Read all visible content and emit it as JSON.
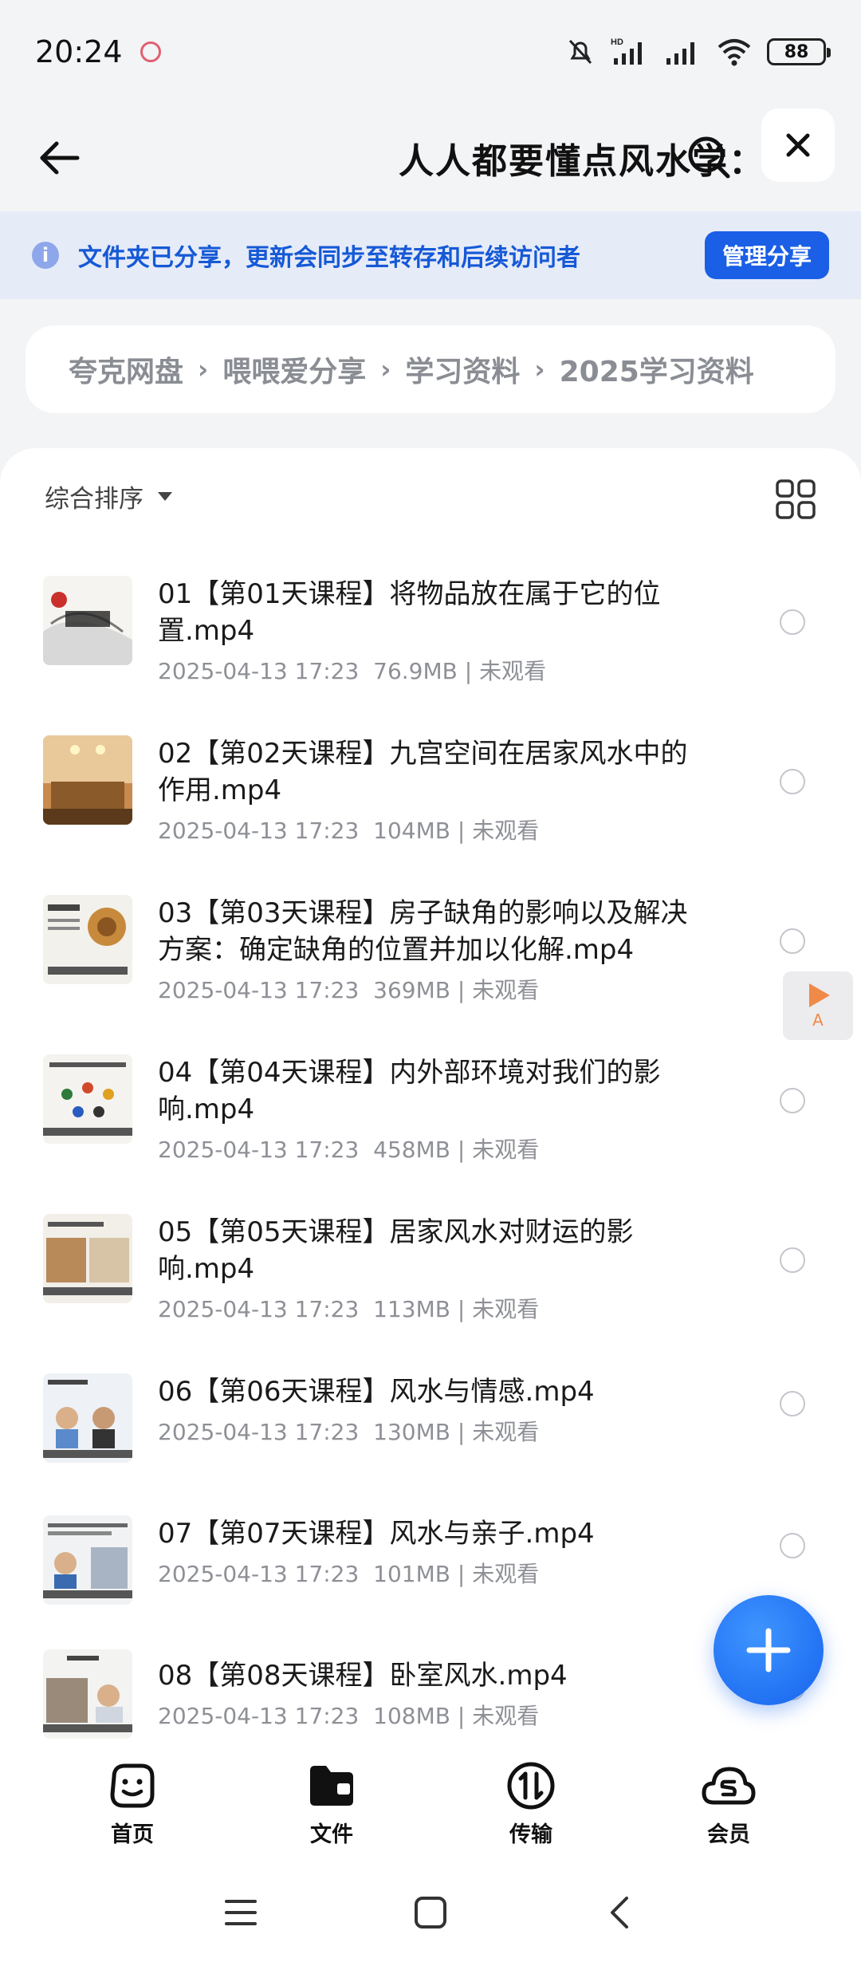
{
  "status_bar": {
    "time": "20:24",
    "battery": "88"
  },
  "header": {
    "title": "人人都要懂点风水学：1..."
  },
  "share_banner": {
    "text": "文件夹已分享，更新会同步至转存和后续访问者",
    "button": "管理分享"
  },
  "breadcrumb": [
    "夸克网盘",
    "喂喂爱分享",
    "学习资料",
    "2025学习资料"
  ],
  "toolbar": {
    "sort_label": "综合排序"
  },
  "files": [
    {
      "name": "01【第01天课程】将物品放在属于它的位置.mp4",
      "date": "2025-04-13 17:23",
      "size": "76.9MB",
      "status": "未观看"
    },
    {
      "name": "02【第02天课程】九宫空间在居家风水中的作用.mp4",
      "date": "2025-04-13 17:23",
      "size": "104MB",
      "status": "未观看"
    },
    {
      "name": "03【第03天课程】房子缺角的影响以及解决方案：确定缺角的位置并加以化解.mp4",
      "date": "2025-04-13 17:23",
      "size": "369MB",
      "status": "未观看"
    },
    {
      "name": "04【第04天课程】内外部环境对我们的影响.mp4",
      "date": "2025-04-13 17:23",
      "size": "458MB",
      "status": "未观看"
    },
    {
      "name": "05【第05天课程】居家风水对财运的影响.mp4",
      "date": "2025-04-13 17:23",
      "size": "113MB",
      "status": "未观看"
    },
    {
      "name": "06【第06天课程】风水与情感.mp4",
      "date": "2025-04-13 17:23",
      "size": "130MB",
      "status": "未观看"
    },
    {
      "name": "07【第07天课程】风水与亲子.mp4",
      "date": "2025-04-13 17:23",
      "size": "101MB",
      "status": "未观看"
    },
    {
      "name": "08【第08天课程】卧室风水.mp4",
      "date": "2025-04-13 17:23",
      "size": "108MB",
      "status": "未观看"
    }
  ],
  "side_float": {
    "letter": "A"
  },
  "bottom_nav": [
    {
      "label": "首页",
      "icon": "home-face-icon"
    },
    {
      "label": "文件",
      "icon": "folder-icon"
    },
    {
      "label": "传输",
      "icon": "transfer-icon"
    },
    {
      "label": "会员",
      "icon": "vip-cloud-icon"
    }
  ]
}
